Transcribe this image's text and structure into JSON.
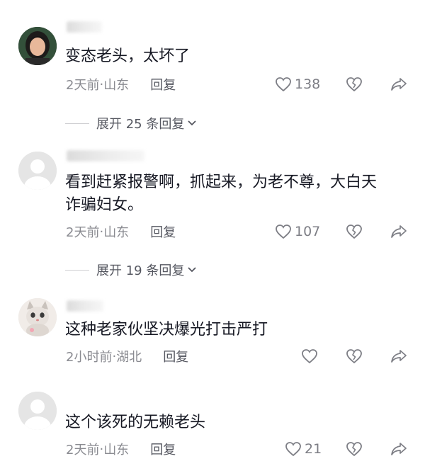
{
  "comments": [
    {
      "text_lines": [
        "变态老头，太坏了"
      ],
      "time": "2天前",
      "location": "山东",
      "reply_label": "回复",
      "like_count": "138",
      "expand_label": "展开 25 条回复"
    },
    {
      "text_lines": [
        "看到赶紧报警啊，抓起来，为老不尊，大白天",
        "诈骗妇女。"
      ],
      "time": "2天前",
      "location": "山东",
      "reply_label": "回复",
      "like_count": "107",
      "expand_label": "展开 19 条回复"
    },
    {
      "text_lines": [
        "这种老家伙坚决爆光打击严打"
      ],
      "time": "2小时前",
      "location": "湖北",
      "reply_label": "回复",
      "like_count": ""
    },
    {
      "text_lines": [
        "这个该死的无赖老头"
      ],
      "time": "2天前",
      "location": "山东",
      "reply_label": "回复",
      "like_count": "21"
    }
  ],
  "meta_separator": " · ",
  "icons": {
    "like": "heart-outline-icon",
    "dislike": "broken-heart-icon",
    "share": "share-arrow-icon",
    "expand": "chevron-down-icon"
  },
  "colors": {
    "text": "#161823",
    "meta": "#8a8b91",
    "icon": "#7d7e85"
  }
}
